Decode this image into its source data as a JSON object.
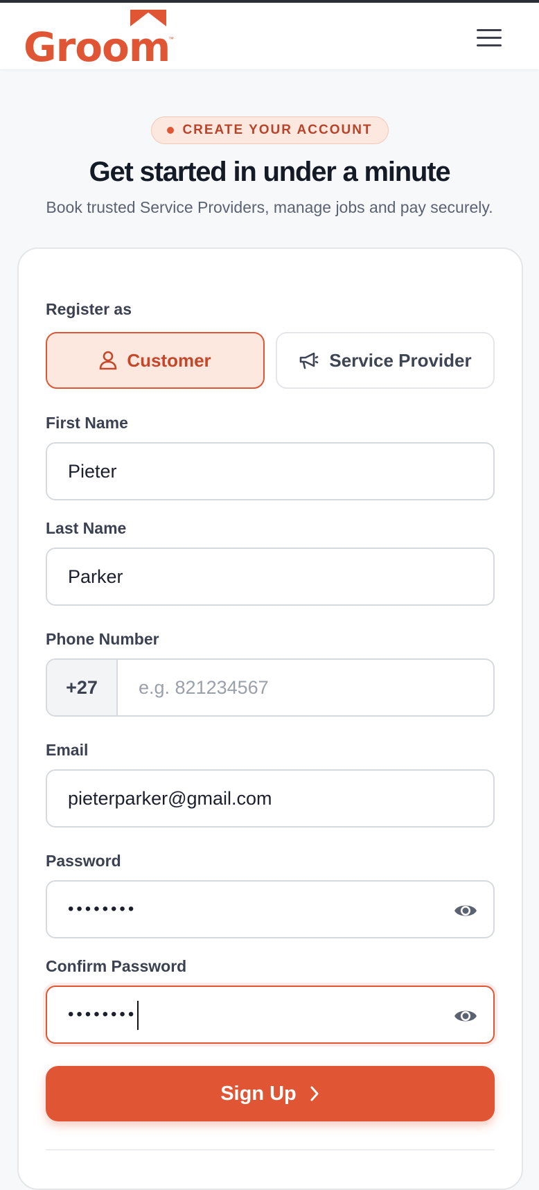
{
  "brand": {
    "name": "Groom",
    "tm": "™",
    "color": "#e05634"
  },
  "header": {
    "menu_icon": "hamburger-menu-icon"
  },
  "hero": {
    "badge": "CREATE YOUR ACCOUNT",
    "title": "Get started in under a minute",
    "subtitle": "Book trusted Service Providers, manage jobs and pay securely."
  },
  "form": {
    "register_as_label": "Register as",
    "roles": [
      {
        "label": "Customer",
        "icon": "person-icon",
        "selected": true
      },
      {
        "label": "Service Provider",
        "icon": "megaphone-icon",
        "selected": false
      }
    ],
    "first_name": {
      "label": "First Name",
      "value": "Pieter"
    },
    "last_name": {
      "label": "Last Name",
      "value": "Parker"
    },
    "phone": {
      "label": "Phone Number",
      "country_code": "+27",
      "value": "",
      "placeholder": "e.g. 821234567"
    },
    "email": {
      "label": "Email",
      "value": "pieterparker@gmail.com"
    },
    "password": {
      "label": "Password",
      "value": "••••••••"
    },
    "confirm_password": {
      "label": "Confirm Password",
      "value": "••••••••"
    },
    "submit_label": "Sign Up"
  }
}
